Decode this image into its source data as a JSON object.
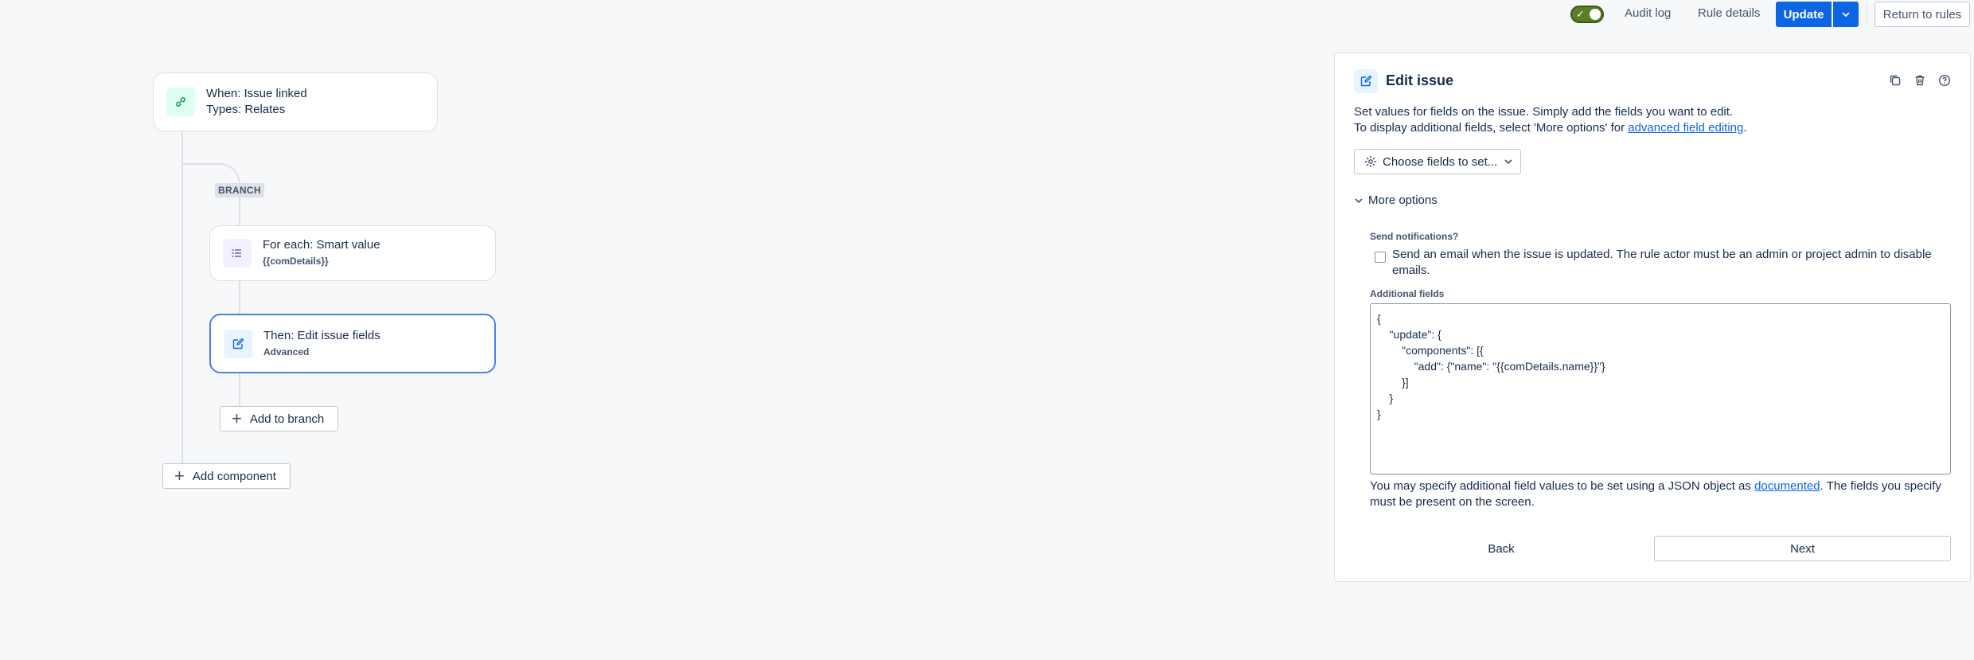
{
  "topbar": {
    "enabled": true,
    "audit_log": "Audit log",
    "rule_details": "Rule details",
    "update": "Update",
    "return_to_rules": "Return to rules"
  },
  "flow": {
    "trigger": {
      "line1": "When: Issue linked",
      "line2": "Types: Relates",
      "icon": "link-icon"
    },
    "branch_label": "BRANCH",
    "branch": {
      "line1": "For each: Smart value",
      "line2": "{{comDetails}}",
      "icon": "list-icon"
    },
    "action": {
      "line1": "Then: Edit issue fields",
      "line2": "Advanced",
      "icon": "edit-icon"
    },
    "add_to_branch": "Add to branch",
    "add_component": "Add component"
  },
  "panel": {
    "title": "Edit issue",
    "description_line1": "Set values for fields on the issue. Simply add the fields you want to edit.",
    "description_line2_prefix": "To display additional fields, select 'More options' for ",
    "description_link": "advanced field editing",
    "description_suffix": ".",
    "choose_fields": "Choose fields to set...",
    "more_options": "More options",
    "send_notifications_label": "Send notifications?",
    "send_notifications_checked": false,
    "send_notifications_text": "Send an email when the issue is updated. The rule actor must be an admin or project admin to disable emails.",
    "additional_fields_label": "Additional fields",
    "additional_fields_value": "{\n    \"update\": {\n        \"components\": [{\n            \"add\": {\"name\": \"{{comDetails.name}}\"}\n        }]\n    }\n}",
    "help_prefix": "You may specify additional field values to be set using a JSON object as ",
    "help_link": "documented",
    "help_suffix": ". The fields you specify must be present on the screen.",
    "back": "Back",
    "next": "Next"
  },
  "colors": {
    "primary": "#0c66e4",
    "toggle_on": "#5b7f24",
    "selected_border": "#4c7ef0"
  }
}
